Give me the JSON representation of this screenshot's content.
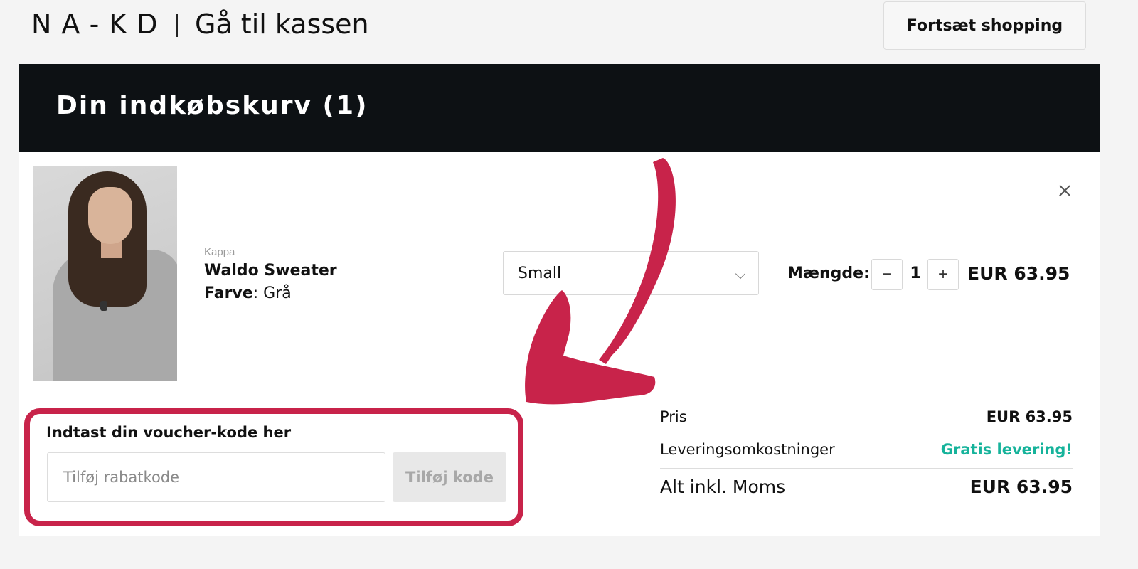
{
  "header": {
    "logo": "NA-KD",
    "checkout_title": "Gå til kassen",
    "continue_label": "Fortsæt shopping"
  },
  "cart": {
    "title": "Din indkøbskurv (1)",
    "item": {
      "brand": "Kappa",
      "name": "Waldo Sweater",
      "color_label": "Farve",
      "color_value": ": Grå",
      "size": "Small",
      "qty_label": "Mængde:",
      "quantity": "1",
      "minus": "−",
      "plus": "+",
      "price": "EUR 63.95",
      "image_icon": "product-photo"
    }
  },
  "voucher": {
    "label": "Indtast din voucher-kode her",
    "placeholder": "Tilføj rabatkode",
    "button_label": "Tilføj kode",
    "highlight_color": "#c8234a"
  },
  "summary": {
    "price_label": "Pris",
    "price_value": "EUR 63.95",
    "delivery_label": "Leveringsomkostninger",
    "delivery_value": "Gratis levering!",
    "total_label": "Alt inkl. Moms",
    "total_value": "EUR 63.95",
    "accent_green": "#16b39b"
  },
  "annotation": {
    "arrow_color": "#c8234a"
  }
}
